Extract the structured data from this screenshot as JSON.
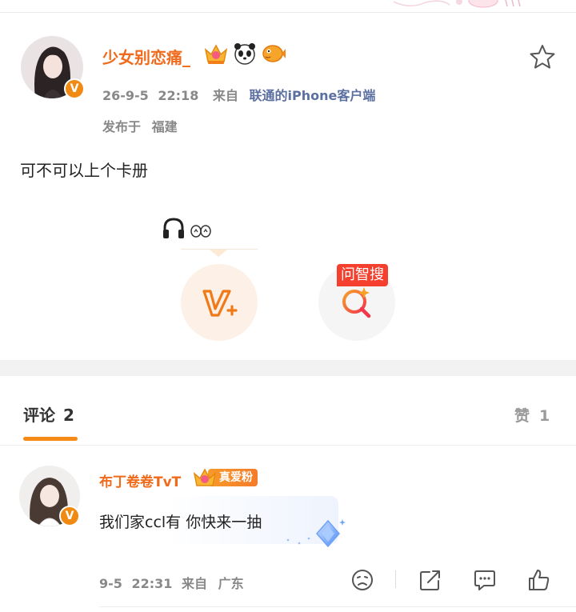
{
  "post": {
    "username": "少女别恋痛_",
    "badges": [
      "crown-badge-icon",
      "panda-badge-icon",
      "puffer-fish-badge-icon"
    ],
    "date": "26-9-5",
    "time": "22:18",
    "source_prefix": "来自",
    "source_client": "联通的iPhone客户端",
    "location_label": "发布于",
    "location": "福建",
    "content": "可不可以上个卡册",
    "favorite_icon": "star-icon",
    "verified_mark": "V"
  },
  "actions": {
    "ask_search_label": "问智搜"
  },
  "tabs": {
    "comments_label": "评论",
    "comments_count": "2",
    "likes_label": "赞",
    "likes_count": "1",
    "accent_color": "#f58b16"
  },
  "comment": {
    "username": "布丁卷卷TvT",
    "fan_badge": "真爱粉",
    "text": "我们家ccl有  你快来一抽",
    "date": "9-5",
    "time": "22:31",
    "source_prefix": "来自",
    "location": "广东",
    "verified_mark": "V"
  },
  "colors": {
    "username": "#f06a1b",
    "source_link": "#5b6fa0",
    "ask_tag": "#f5402f"
  }
}
